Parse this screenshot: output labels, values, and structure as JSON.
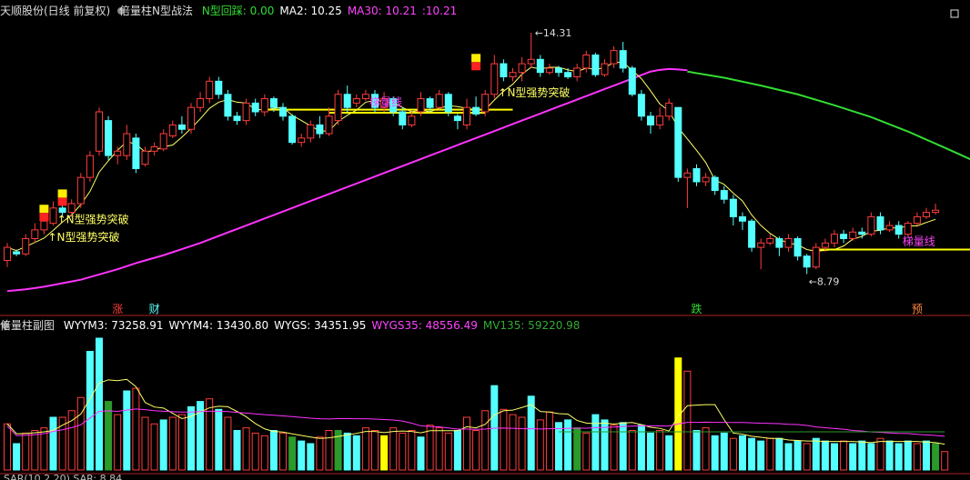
{
  "main_header": {
    "stock": "天顺股份(日线 前复权)",
    "indicator": "倍量柱N型战法",
    "items": [
      {
        "label": "N型回踩: 0.00",
        "color": "#33dd33"
      },
      {
        "label": "MA2: 10.25",
        "color": "#ffffff"
      },
      {
        "label": "MA30: 10.21",
        "color": "#ff44ff"
      },
      {
        "label": ":10.21",
        "color": "#ff44ff"
      }
    ]
  },
  "sub_header": {
    "indicator": "倍量柱副图",
    "items": [
      {
        "label": "WYYM3: 73258.91",
        "color": "#ffffff"
      },
      {
        "label": "WYYM4: 13430.80",
        "color": "#ffffff"
      },
      {
        "label": "WYGS: 34351.95",
        "color": "#ffffff"
      },
      {
        "label": "WYGS35: 48556.49",
        "color": "#ff44ff"
      },
      {
        "label": "MV135: 59220.98",
        "color": "#33aa33"
      }
    ]
  },
  "bottom_cut_text": "SAR(10,2,20) SAR: 8.84",
  "colors": {
    "up": "#ff3c3c",
    "down": "#54ffff",
    "ma_short": "#ffff66",
    "ma30": "#ff33ff",
    "ma_green": "#33dd33",
    "ladder": "#ffff00",
    "vol_green": "#2a9a2a",
    "vol_yellow": "#ffff00"
  },
  "chart_data": {
    "type": "candlestick",
    "price_axis": [
      8.3,
      14.6
    ],
    "high_label": "14.31",
    "low_label": "8.79",
    "candles": [
      [
        9.1,
        9.4,
        8.95,
        9.5
      ],
      [
        9.3,
        9.25,
        9.2,
        9.35
      ],
      [
        9.25,
        9.6,
        9.2,
        9.7
      ],
      [
        9.6,
        9.8,
        9.5,
        9.95
      ],
      [
        9.8,
        10.0,
        9.7,
        10.1
      ],
      [
        9.95,
        10.3,
        9.9,
        10.45
      ],
      [
        10.3,
        10.2,
        10.1,
        10.5
      ],
      [
        10.2,
        10.4,
        10.1,
        10.5
      ],
      [
        10.4,
        11.0,
        10.3,
        11.1
      ],
      [
        11.0,
        11.5,
        10.9,
        11.6
      ],
      [
        11.6,
        12.5,
        11.5,
        12.6
      ],
      [
        12.3,
        11.5,
        11.4,
        12.4
      ],
      [
        11.5,
        11.6,
        11.3,
        11.7
      ],
      [
        11.5,
        12.0,
        11.4,
        12.2
      ],
      [
        11.9,
        11.2,
        11.1,
        12.0
      ],
      [
        11.3,
        11.6,
        11.25,
        11.7
      ],
      [
        11.6,
        11.7,
        11.5,
        11.8
      ],
      [
        11.65,
        12.0,
        11.6,
        12.1
      ],
      [
        11.95,
        12.2,
        11.9,
        12.3
      ],
      [
        12.2,
        12.1,
        12.0,
        12.4
      ],
      [
        12.1,
        12.6,
        12.0,
        12.7
      ],
      [
        12.6,
        12.8,
        12.5,
        12.95
      ],
      [
        12.8,
        13.2,
        12.7,
        13.3
      ],
      [
        13.2,
        12.9,
        12.8,
        13.3
      ],
      [
        12.9,
        12.4,
        12.3,
        13.0
      ],
      [
        12.4,
        12.3,
        12.2,
        12.5
      ],
      [
        12.3,
        12.7,
        12.2,
        12.8
      ],
      [
        12.7,
        12.5,
        12.4,
        12.8
      ],
      [
        12.5,
        12.8,
        12.4,
        12.9
      ],
      [
        12.8,
        12.6,
        12.5,
        12.85
      ],
      [
        12.6,
        12.4,
        12.3,
        12.7
      ],
      [
        12.4,
        11.8,
        11.75,
        12.45
      ],
      [
        11.8,
        11.9,
        11.7,
        12.0
      ],
      [
        11.9,
        12.2,
        11.8,
        12.3
      ],
      [
        12.2,
        12.0,
        11.9,
        12.4
      ],
      [
        12.0,
        12.4,
        11.95,
        12.6
      ],
      [
        12.3,
        12.9,
        12.2,
        13.0
      ],
      [
        12.9,
        12.6,
        12.5,
        13.1
      ],
      [
        12.7,
        12.8,
        12.6,
        12.9
      ],
      [
        12.8,
        12.9,
        12.75,
        13.0
      ],
      [
        12.9,
        12.6,
        12.5,
        13.0
      ],
      [
        12.6,
        12.8,
        12.5,
        12.95
      ],
      [
        12.8,
        12.5,
        12.4,
        12.85
      ],
      [
        12.5,
        12.2,
        12.1,
        12.6
      ],
      [
        12.2,
        12.4,
        12.15,
        12.5
      ],
      [
        12.5,
        12.8,
        12.4,
        12.95
      ],
      [
        12.8,
        12.6,
        12.5,
        12.85
      ],
      [
        12.6,
        12.9,
        12.55,
        13.0
      ],
      [
        12.9,
        12.5,
        12.4,
        12.95
      ],
      [
        12.4,
        12.3,
        12.1,
        12.45
      ],
      [
        12.2,
        12.6,
        12.1,
        12.8
      ],
      [
        12.6,
        12.45,
        12.4,
        12.85
      ],
      [
        12.5,
        12.9,
        12.4,
        13.0
      ],
      [
        12.9,
        13.6,
        12.8,
        13.8
      ],
      [
        13.6,
        13.3,
        13.2,
        13.7
      ],
      [
        13.3,
        13.4,
        13.2,
        13.5
      ],
      [
        13.4,
        13.6,
        13.2,
        13.75
      ],
      [
        13.6,
        13.7,
        13.5,
        14.31
      ],
      [
        13.7,
        13.4,
        13.3,
        13.8
      ],
      [
        13.4,
        13.5,
        13.35,
        13.6
      ],
      [
        13.5,
        13.4,
        13.3,
        13.55
      ],
      [
        13.4,
        13.3,
        13.25,
        13.5
      ],
      [
        13.3,
        13.5,
        13.2,
        13.6
      ],
      [
        13.5,
        13.8,
        13.4,
        13.9
      ],
      [
        13.8,
        13.35,
        13.3,
        13.85
      ],
      [
        13.35,
        13.6,
        13.3,
        13.7
      ],
      [
        13.6,
        13.9,
        13.5,
        14.0
      ],
      [
        13.9,
        13.5,
        13.4,
        14.1
      ],
      [
        13.5,
        12.9,
        12.85,
        13.55
      ],
      [
        12.9,
        12.4,
        12.3,
        13.0
      ],
      [
        12.4,
        12.2,
        12.0,
        12.5
      ],
      [
        12.2,
        12.4,
        12.1,
        12.6
      ],
      [
        12.4,
        12.7,
        12.3,
        12.8
      ],
      [
        12.6,
        11.0,
        10.9,
        12.6
      ],
      [
        11.0,
        11.1,
        10.3,
        11.2
      ],
      [
        11.2,
        10.9,
        10.8,
        11.3
      ],
      [
        10.9,
        11.0,
        10.8,
        11.1
      ],
      [
        11.0,
        10.7,
        10.6,
        11.05
      ],
      [
        10.7,
        10.5,
        10.4,
        10.8
      ],
      [
        10.5,
        10.1,
        9.9,
        10.6
      ],
      [
        10.1,
        10.0,
        9.8,
        10.2
      ],
      [
        10.0,
        9.4,
        9.3,
        10.05
      ],
      [
        9.4,
        9.5,
        8.9,
        9.6
      ],
      [
        9.5,
        9.6,
        9.45,
        9.7
      ],
      [
        9.6,
        9.4,
        9.2,
        9.65
      ],
      [
        9.4,
        9.6,
        9.3,
        9.7
      ],
      [
        9.6,
        9.2,
        9.1,
        9.65
      ],
      [
        9.2,
        8.95,
        8.79,
        9.25
      ],
      [
        8.95,
        9.4,
        8.9,
        9.5
      ],
      [
        9.4,
        9.5,
        9.3,
        9.6
      ],
      [
        9.5,
        9.7,
        9.4,
        9.8
      ],
      [
        9.7,
        9.6,
        9.5,
        9.8
      ],
      [
        9.6,
        9.75,
        9.55,
        9.85
      ],
      [
        9.75,
        9.7,
        9.6,
        9.85
      ],
      [
        9.7,
        10.1,
        9.65,
        10.2
      ],
      [
        10.1,
        9.8,
        9.7,
        10.2
      ],
      [
        9.8,
        9.9,
        9.75,
        10.0
      ],
      [
        9.9,
        9.7,
        9.6,
        10.0
      ],
      [
        9.7,
        9.95,
        9.65,
        10.0
      ],
      [
        9.95,
        10.1,
        9.9,
        10.2
      ],
      [
        10.1,
        10.2,
        10.05,
        10.3
      ],
      [
        10.2,
        10.25,
        10.15,
        10.4
      ]
    ],
    "ma30": [
      8.4,
      8.42,
      8.44,
      8.47,
      8.5,
      8.54,
      8.58,
      8.62,
      8.66,
      8.72,
      8.78,
      8.84,
      8.9,
      8.97,
      9.04,
      9.1,
      9.16,
      9.22,
      9.29,
      9.36,
      9.43,
      9.5,
      9.58,
      9.66,
      9.74,
      9.82,
      9.9,
      9.98,
      10.06,
      10.14,
      10.22,
      10.3,
      10.38,
      10.46,
      10.54,
      10.62,
      10.7,
      10.78,
      10.86,
      10.94,
      11.02,
      11.1,
      11.18,
      11.26,
      11.34,
      11.42,
      11.5,
      11.58,
      11.66,
      11.74,
      11.82,
      11.9,
      11.98,
      12.06,
      12.14,
      12.22,
      12.3,
      12.38,
      12.46,
      12.54,
      12.62,
      12.7,
      12.78,
      12.86,
      12.94,
      13.02,
      13.1,
      13.18,
      13.26,
      13.34,
      13.42,
      13.46,
      13.48,
      13.47,
      13.45
    ],
    "green_line": [
      [
        74,
        13.42
      ],
      [
        78,
        13.28
      ],
      [
        82,
        13.1
      ],
      [
        86,
        12.9
      ],
      [
        90,
        12.65
      ],
      [
        94,
        12.38
      ],
      [
        98,
        12.05
      ],
      [
        102,
        11.68
      ],
      [
        106,
        11.3
      ],
      [
        110,
        10.95
      ],
      [
        114,
        10.62
      ],
      [
        118,
        10.35
      ]
    ],
    "ladder_lines": [
      [
        28,
        55,
        12.55
      ],
      [
        35,
        52,
        12.48
      ],
      [
        88,
        118,
        9.35
      ]
    ],
    "annotations": [
      {
        "text": "↑N型强势突破",
        "idx": 6,
        "price": 9.95,
        "color": "#ffff66"
      },
      {
        "text": "↑N型强势突破",
        "idx": 5,
        "price": 9.55,
        "color": "#ffff66"
      },
      {
        "text": "↑N型强势突破",
        "idx": 54,
        "price": 12.85,
        "color": "#ffff66"
      },
      {
        "text": "梯量线",
        "idx": 40,
        "price": 12.63,
        "color": "#ff44ff"
      },
      {
        "text": "梯量线",
        "idx": 98,
        "price": 9.45,
        "color": "#ff44ff"
      }
    ],
    "markers": [
      {
        "text": "涨",
        "x_idx": 12,
        "color": "#ff3c3c"
      },
      {
        "text": "财",
        "x_idx": 16,
        "color": "#54ffff"
      },
      {
        "text": "跌",
        "x_idx": 75,
        "color": "#33dd33"
      },
      {
        "text": "预",
        "x_idx": 99,
        "color": "#ff8844"
      }
    ],
    "volume": [
      0.35,
      0.2,
      0.28,
      0.3,
      0.32,
      0.4,
      0.4,
      0.45,
      0.55,
      0.9,
      1.0,
      0.52,
      0.42,
      0.6,
      0.62,
      0.4,
      0.35,
      0.38,
      0.4,
      0.42,
      0.48,
      0.52,
      0.54,
      0.46,
      0.4,
      0.3,
      0.32,
      0.28,
      0.26,
      0.3,
      0.28,
      0.25,
      0.22,
      0.2,
      0.25,
      0.3,
      0.3,
      0.28,
      0.26,
      0.32,
      0.3,
      0.26,
      0.32,
      0.28,
      0.3,
      0.25,
      0.34,
      0.32,
      0.28,
      0.3,
      0.4,
      0.3,
      0.45,
      0.64,
      0.46,
      0.42,
      0.4,
      0.56,
      0.38,
      0.44,
      0.36,
      0.38,
      0.32,
      0.28,
      0.42,
      0.38,
      0.34,
      0.36,
      0.3,
      0.34,
      0.28,
      0.3,
      0.26,
      0.85,
      0.75,
      0.3,
      0.32,
      0.26,
      0.28,
      0.24,
      0.26,
      0.24,
      0.22,
      0.24,
      0.24,
      0.2,
      0.22,
      0.2,
      0.24,
      0.22,
      0.2,
      0.22,
      0.2,
      0.22,
      0.2,
      0.24,
      0.22,
      0.2,
      0.22,
      0.2,
      0.22,
      0.2,
      0.14
    ],
    "volume_colors": "rrrrrrrrrcccrrrrrrrrrrrrrrrrrrrcrrrrrrrrrrrrrrrrrrrrrrrcrrrrrrrrrrrrrrrrrrrrrrrrrrrrrrrrrrrrrrrrrrrrrrr"
  }
}
